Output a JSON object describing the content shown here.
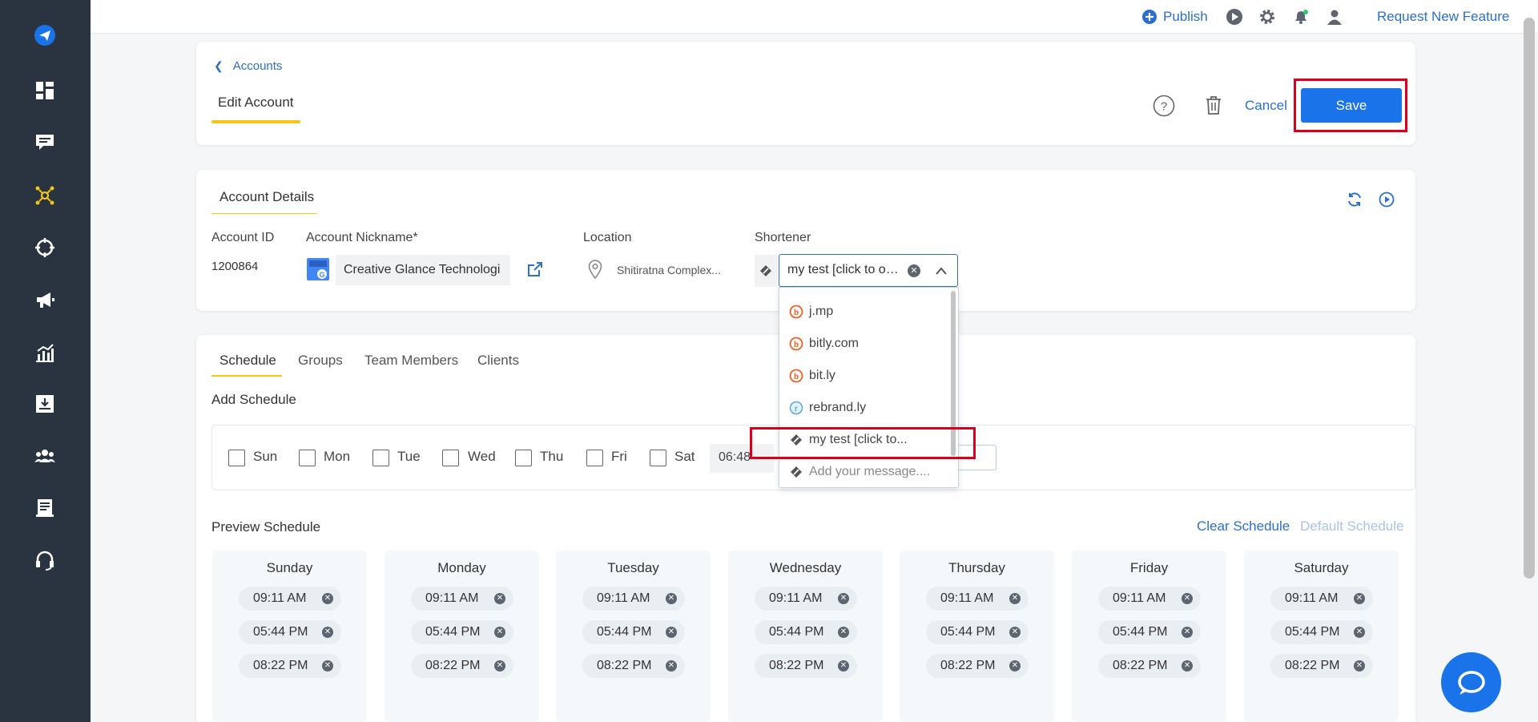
{
  "topbar": {
    "publish_label": "Publish",
    "request_feature_label": "Request New Feature"
  },
  "header": {
    "breadcrumb": "Accounts",
    "tab_label": "Edit Account",
    "cancel_label": "Cancel",
    "save_label": "Save"
  },
  "account_details": {
    "section_title": "Account Details",
    "account_id_label": "Account ID",
    "account_id_value": "1200864",
    "nickname_label": "Account Nickname*",
    "nickname_value": "Creative Glance Technologi",
    "location_label": "Location",
    "location_value": "Shitiratna Complex...",
    "shortener_label": "Shortener",
    "shortener_value": "my test [click to o…"
  },
  "shortener_dropdown": {
    "options": [
      {
        "label": "j.mp",
        "icon": "bitly-icon"
      },
      {
        "label": "bitly.com",
        "icon": "bitly-icon"
      },
      {
        "label": "bit.ly",
        "icon": "bitly-icon"
      },
      {
        "label": "rebrand.ly",
        "icon": "rebrandly-icon"
      },
      {
        "label": "my test [click to...",
        "icon": "link-tag-icon"
      },
      {
        "label": "Add your message....",
        "icon": "link-tag-icon"
      }
    ]
  },
  "schedule_tabs": [
    "Schedule",
    "Groups",
    "Team Members",
    "Clients"
  ],
  "add_schedule": {
    "title": "Add Schedule",
    "days": [
      "Sun",
      "Mon",
      "Tue",
      "Wed",
      "Thu",
      "Fri",
      "Sat"
    ],
    "time_value": "06:48"
  },
  "preview": {
    "title": "Preview Schedule",
    "clear_label": "Clear Schedule",
    "default_label": "Default Schedule",
    "days": [
      {
        "name": "Sunday",
        "times": [
          "09:11 AM",
          "05:44 PM",
          "08:22 PM"
        ]
      },
      {
        "name": "Monday",
        "times": [
          "09:11 AM",
          "05:44 PM",
          "08:22 PM"
        ]
      },
      {
        "name": "Tuesday",
        "times": [
          "09:11 AM",
          "05:44 PM",
          "08:22 PM"
        ]
      },
      {
        "name": "Wednesday",
        "times": [
          "09:11 AM",
          "05:44 PM",
          "08:22 PM"
        ]
      },
      {
        "name": "Thursday",
        "times": [
          "09:11 AM",
          "05:44 PM",
          "08:22 PM"
        ]
      },
      {
        "name": "Friday",
        "times": [
          "09:11 AM",
          "05:44 PM",
          "08:22 PM"
        ]
      },
      {
        "name": "Saturday",
        "times": [
          "09:11 AM",
          "05:44 PM",
          "08:22 PM"
        ]
      }
    ]
  },
  "colors": {
    "sidebar": "#2a3340",
    "accent_blue": "#1a73e8",
    "highlight_yellow": "#f5c518",
    "annotation_red": "#d9001b"
  }
}
